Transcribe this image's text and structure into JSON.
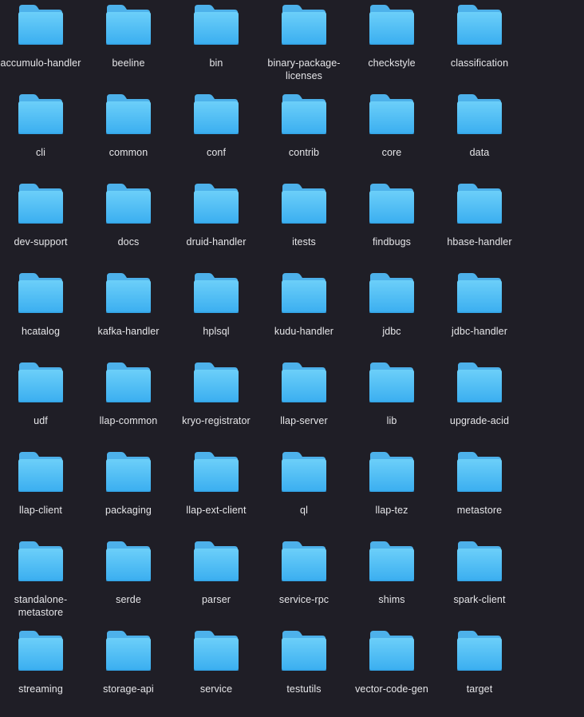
{
  "window": {
    "view": "icon-grid"
  },
  "icon": {
    "name": "folder-icon",
    "colors": {
      "tab": "#4db1ea",
      "body_top": "#6ccff9",
      "body_bottom": "#3aaef0",
      "edge": "#2f9ce0",
      "background": "#1f1e26",
      "label_text": "#e6e6e9"
    }
  },
  "folders": [
    {
      "label": "accumulo-handler"
    },
    {
      "label": "beeline"
    },
    {
      "label": "bin"
    },
    {
      "label": "binary-package-licenses"
    },
    {
      "label": "checkstyle"
    },
    {
      "label": "classification"
    },
    {
      "label": "cli"
    },
    {
      "label": "common"
    },
    {
      "label": "conf"
    },
    {
      "label": "contrib"
    },
    {
      "label": "core"
    },
    {
      "label": "data"
    },
    {
      "label": "dev-support"
    },
    {
      "label": "docs"
    },
    {
      "label": "druid-handler"
    },
    {
      "label": "itests"
    },
    {
      "label": "findbugs"
    },
    {
      "label": "hbase-handler"
    },
    {
      "label": "hcatalog"
    },
    {
      "label": "kafka-handler"
    },
    {
      "label": "hplsql"
    },
    {
      "label": "kudu-handler"
    },
    {
      "label": "jdbc"
    },
    {
      "label": "jdbc-handler"
    },
    {
      "label": "udf"
    },
    {
      "label": "llap-common"
    },
    {
      "label": "kryo-registrator"
    },
    {
      "label": "llap-server"
    },
    {
      "label": "lib"
    },
    {
      "label": "upgrade-acid"
    },
    {
      "label": "llap-client"
    },
    {
      "label": "packaging"
    },
    {
      "label": "llap-ext-client"
    },
    {
      "label": "ql"
    },
    {
      "label": "llap-tez"
    },
    {
      "label": "metastore"
    },
    {
      "label": "standalone-metastore"
    },
    {
      "label": "serde"
    },
    {
      "label": "parser"
    },
    {
      "label": "service-rpc"
    },
    {
      "label": "shims"
    },
    {
      "label": "spark-client"
    },
    {
      "label": "streaming"
    },
    {
      "label": "storage-api"
    },
    {
      "label": "service"
    },
    {
      "label": "testutils"
    },
    {
      "label": "vector-code-gen"
    },
    {
      "label": "target"
    }
  ]
}
